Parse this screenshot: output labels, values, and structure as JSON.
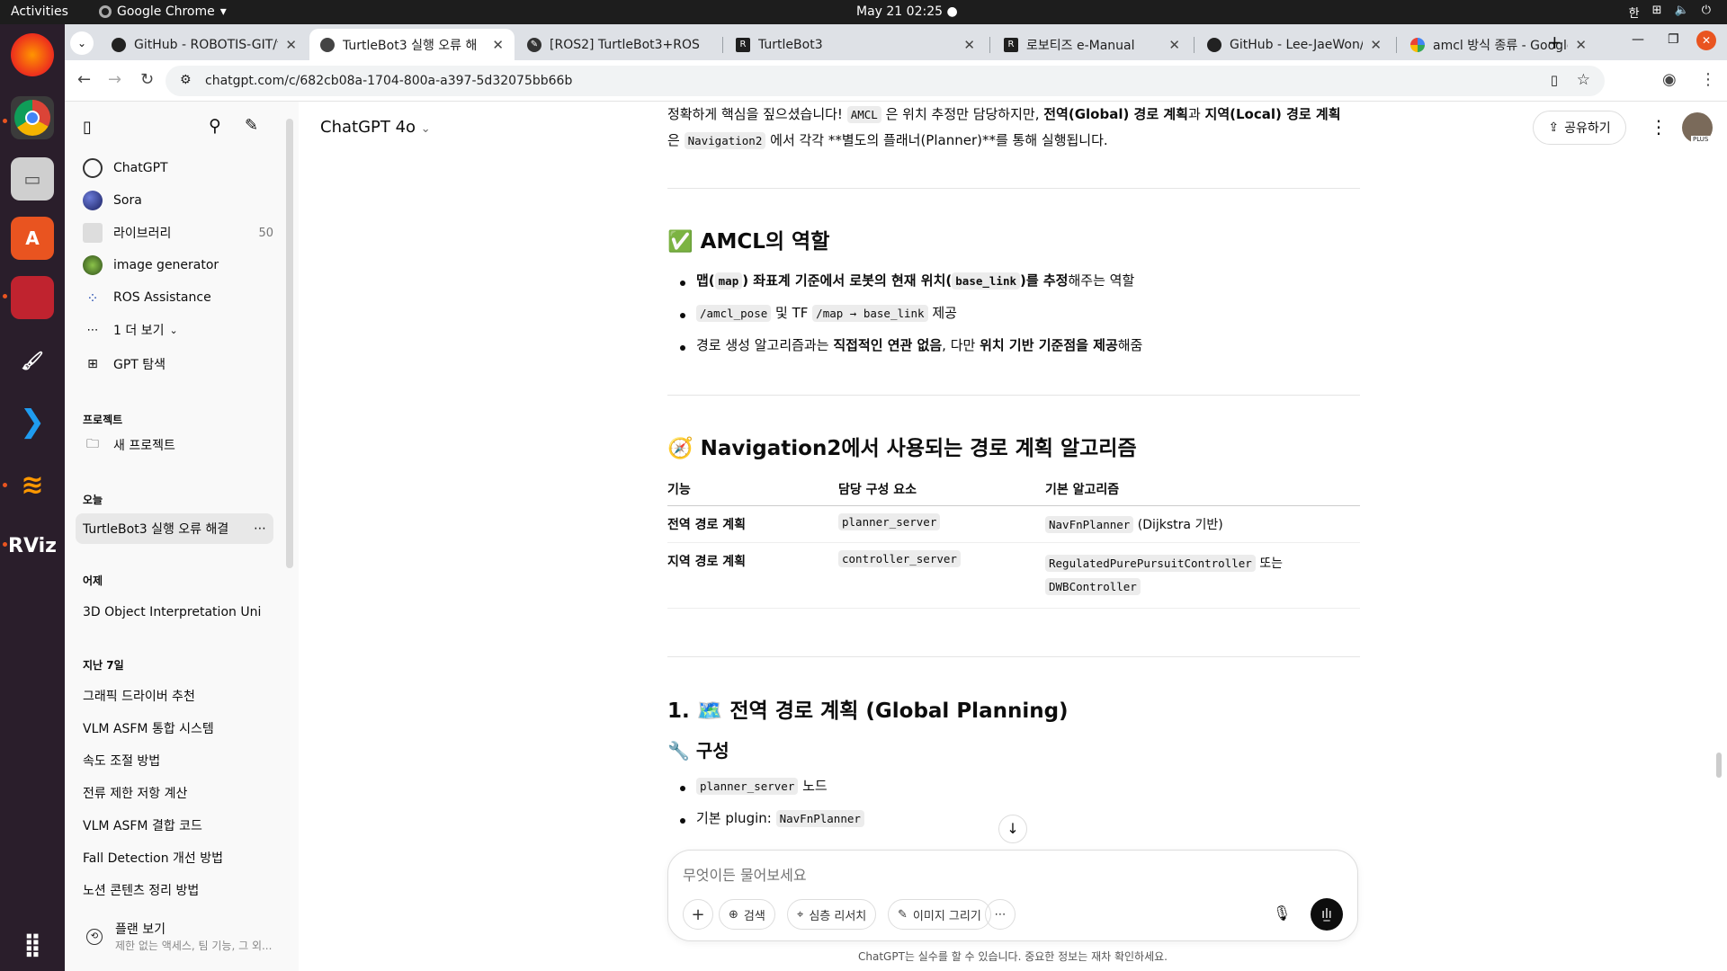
{
  "topbar": {
    "activities": "Activities",
    "app_name": "Google Chrome",
    "clock": "May 21  02:25",
    "input_lang": "한"
  },
  "tabs": [
    {
      "title": "GitHub - ROBOTIS-GIT/t",
      "active": false
    },
    {
      "title": "TurtleBot3 실행 오류 해",
      "active": true
    },
    {
      "title": "[ROS2] TurtleBot3+ROS",
      "active": false
    },
    {
      "title": "TurtleBot3",
      "active": false
    },
    {
      "title": "로보티즈 e-Manual",
      "active": false
    },
    {
      "title": "GitHub - Lee-JaeWon/N",
      "active": false
    },
    {
      "title": "amcl 방식 종류 - Google",
      "active": false
    }
  ],
  "address": {
    "url": "chatgpt.com/c/682cb08a-1704-800a-a397-5d32075bb66b"
  },
  "sidebar": {
    "nav": [
      {
        "label": "ChatGPT"
      },
      {
        "label": "Sora"
      },
      {
        "label": "라이브러리",
        "count": "50"
      },
      {
        "label": "image generator"
      },
      {
        "label": "ROS Assistance"
      },
      {
        "label": "1 더 보기"
      },
      {
        "label": "GPT 탐색"
      }
    ],
    "projects_heading": "프로젝트",
    "new_project": "새 프로젝트",
    "today_heading": "오늘",
    "today_chat": "TurtleBot3 실행 오류 해결",
    "yesterday_heading": "어제",
    "yesterday_chat": "3D Object Interpretation Uni",
    "week_heading": "지난 7일",
    "week_chats": [
      "그래픽 드라이버 추천",
      "VLM ASFM 통합 시스템",
      "속도 조절 방법",
      "전류 제한 저항 계산",
      "VLM ASFM 결합 코드",
      "Fall Detection 개선 방법",
      "노션 콘텐츠 정리 방법"
    ],
    "plan_title": "플랜 보기",
    "plan_sub": "제한 없는 액세스, 팀 기능, 그 외..."
  },
  "header": {
    "model": "ChatGPT 4o",
    "share": "공유하기",
    "avatar_badge": "PLUS"
  },
  "content": {
    "intro": {
      "a": "정확하게 핵심을 짚으셨습니다! ",
      "code1": "AMCL",
      "b": " 은 위치 추정만 담당하지만, ",
      "bold1": "전역(Global) 경로 계획",
      "c": "과 ",
      "bold2": "지역(Local) 경로 계획",
      "d": "은 ",
      "code2": "Navigation2",
      "e": " 에서 각각 **별도의 플래너(Planner)**를 통해 실행됩니다."
    },
    "amcl_heading": "✅ AMCL의 역할",
    "amcl_b1": {
      "a": "맵(",
      "code1": "map",
      "b": ") 좌표계 기준에서 로봇의 현재 위치(",
      "code2": "base_link",
      "c": ")를 추정",
      "d": "해주는 역할"
    },
    "amcl_b2": {
      "code1": "/amcl_pose",
      "a": " 및 TF ",
      "code2": "/map → base_link",
      "b": " 제공"
    },
    "amcl_b3": {
      "a": "경로 생성 알고리즘과는 ",
      "bold1": "직접적인 연관 없음",
      "b": ", 다만 ",
      "bold2": "위치 기반 기준점을 제공",
      "c": "해줌"
    },
    "nav_heading": "🧭 Navigation2에서 사용되는 경로 계획 알고리즘",
    "table": {
      "headers": [
        "기능",
        "담당 구성 요소",
        "기본 알고리즘"
      ],
      "rows": [
        {
          "func": "전역 경로 계획",
          "comp": "planner_server",
          "algo_code": "NavFnPlanner",
          "algo_text": " (Dijkstra 기반)",
          "algo_code2": ""
        },
        {
          "func": "지역 경로 계획",
          "comp": "controller_server",
          "algo_code": "RegulatedPurePursuitController",
          "algo_text": " 또는",
          "algo_code2": "DWBController"
        }
      ]
    },
    "global_heading": "1. 🗺️ 전역 경로 계획 (Global Planning)",
    "config_heading": "🔧 구성",
    "cfg_b1": {
      "code": "planner_server",
      "a": " 노드"
    },
    "cfg_b2": {
      "a": "기본 plugin: ",
      "code": "NavFnPlanner"
    }
  },
  "composer": {
    "placeholder": "무엇이든 물어보세요",
    "search": "검색",
    "deep_research": "심층 리서치",
    "draw_image": "이미지 그리기",
    "footer": "ChatGPT는 실수를 할 수 있습니다. 중요한 정보는 재차 확인하세요."
  }
}
